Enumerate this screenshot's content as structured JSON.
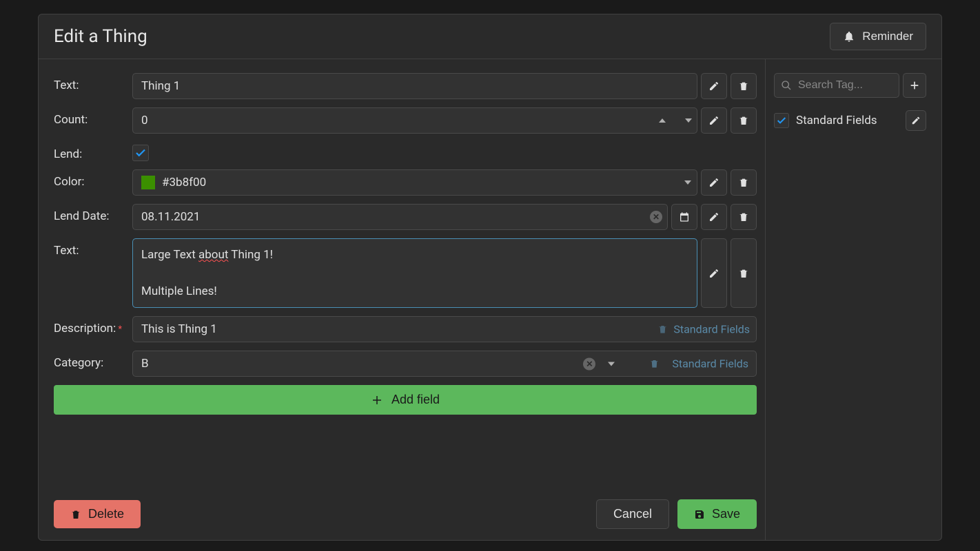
{
  "header": {
    "title": "Edit a Thing",
    "reminder": "Reminder"
  },
  "fields": {
    "text1": {
      "label": "Text:",
      "value": "Thing 1"
    },
    "count": {
      "label": "Count:",
      "value": "0"
    },
    "lend": {
      "label": "Lend:",
      "checked": true
    },
    "color": {
      "label": "Color:",
      "hex": "#3b8f00"
    },
    "lendDate": {
      "label": "Lend Date:",
      "value": "08.11.2021"
    },
    "text2": {
      "label": "Text:",
      "line1_prefix": "Large Text ",
      "line1_spell": "about",
      "line1_suffix": " Thing 1!",
      "line2": "Multiple Lines!"
    },
    "description": {
      "label": "Description:",
      "value": "This is Thing 1",
      "tag": "Standard Fields"
    },
    "category": {
      "label": "Category:",
      "value": "B",
      "tag": "Standard Fields"
    }
  },
  "addFieldLabel": "Add field",
  "sidebar": {
    "searchPlaceholder": "Search Tag...",
    "tags": {
      "standard": "Standard Fields"
    }
  },
  "footer": {
    "delete": "Delete",
    "cancel": "Cancel",
    "save": "Save"
  }
}
